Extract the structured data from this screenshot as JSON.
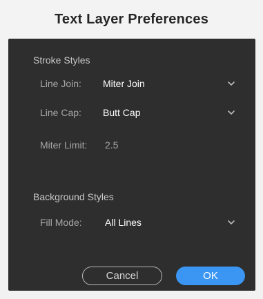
{
  "dialog": {
    "title": "Text Layer Preferences"
  },
  "stroke_styles": {
    "section_label": "Stroke Styles",
    "line_join": {
      "label": "Line Join:",
      "value": "Miter Join"
    },
    "line_cap": {
      "label": "Line Cap:",
      "value": "Butt Cap"
    },
    "miter_limit": {
      "label": "Miter Limit:",
      "value": "2.5"
    }
  },
  "background_styles": {
    "section_label": "Background Styles",
    "fill_mode": {
      "label": "Fill Mode:",
      "value": "All Lines"
    }
  },
  "buttons": {
    "cancel": "Cancel",
    "ok": "OK"
  },
  "colors": {
    "panel_bg": "#2e2e2e",
    "accent": "#3a96f2"
  },
  "icons": {
    "dropdown": "chevron-down-icon"
  }
}
